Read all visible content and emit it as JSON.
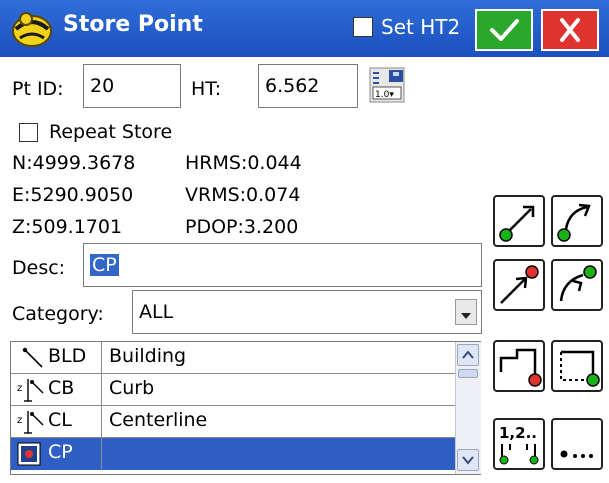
{
  "titlebar": {
    "title": "Store Point",
    "set_ht2_label": "Set HT2",
    "set_ht2_checked": false,
    "ok_icon": "checkmark-icon",
    "cancel_icon": "close-icon",
    "colors": {
      "bar": "#1b4fbf",
      "ok": "#2aa82a",
      "cancel": "#e0322e"
    }
  },
  "form": {
    "pt_id_label": "Pt ID:",
    "pt_id_value": "20",
    "ht_label": "HT:",
    "ht_value": "6.562",
    "calc_icon": "height-calculator-icon",
    "repeat_store_label": "Repeat Store",
    "repeat_store_checked": false
  },
  "coords": {
    "n": "N:4999.3678",
    "e": "E:5290.9050",
    "z": "Z:509.1701",
    "hrms": "HRMS:0.044",
    "vrms": "VRMS:0.074",
    "pdop": "PDOP:3.200"
  },
  "desc": {
    "label": "Desc:",
    "value": "CP"
  },
  "category": {
    "label": "Category:",
    "value": "ALL"
  },
  "feature_list": [
    {
      "code": "BLD",
      "desc": "Building",
      "icon": "line-feature-icon"
    },
    {
      "code": "CB",
      "desc": "Curb",
      "icon": "curb-line-feature-icon"
    },
    {
      "code": "CL",
      "desc": "Centerline",
      "icon": "curb-line-feature-icon"
    },
    {
      "code": "CP",
      "desc": "",
      "icon": "point-feature-icon",
      "selected": true
    }
  ],
  "action_buttons": [
    {
      "name": "line-start-icon"
    },
    {
      "name": "arc-start-icon"
    },
    {
      "name": "line-end-icon"
    },
    {
      "name": "arc-end-icon"
    },
    {
      "name": "close-polyline-icon"
    },
    {
      "name": "rectangle-icon"
    },
    {
      "name": "sequence-points-icon"
    },
    {
      "name": "more-options-icon"
    }
  ]
}
